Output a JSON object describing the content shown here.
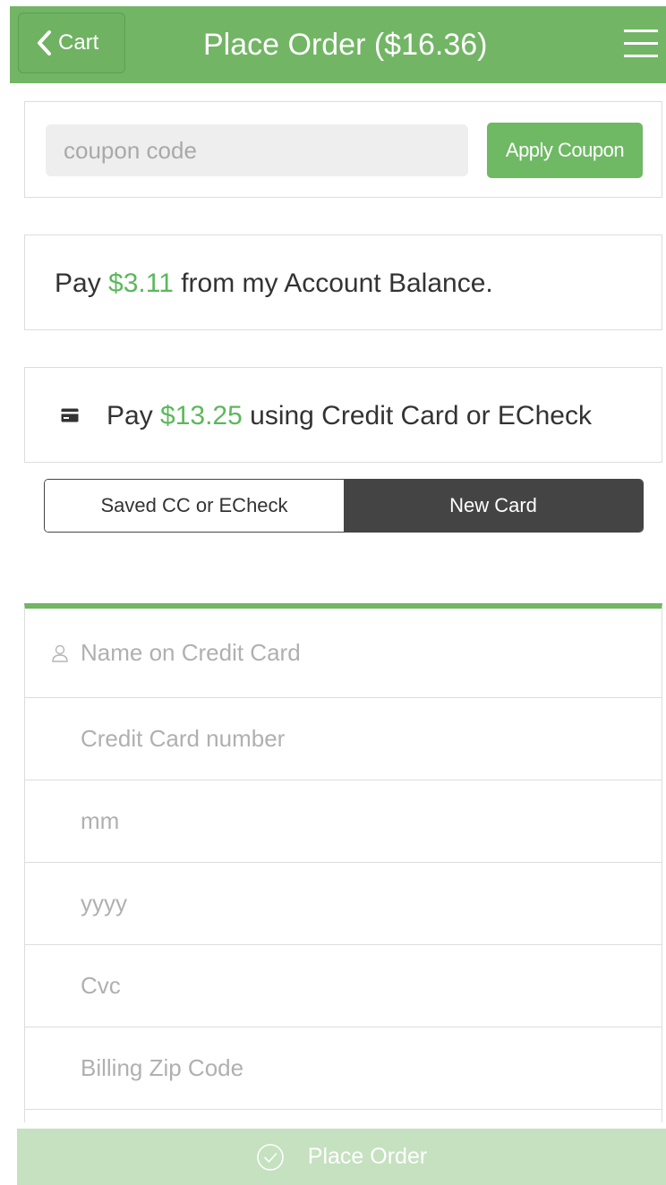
{
  "header": {
    "back_label": "Cart",
    "title": "Place Order ($16.36)",
    "color": "#72b565"
  },
  "coupon": {
    "placeholder": "coupon code",
    "apply_label": "Apply Coupon"
  },
  "account_balance": {
    "prefix": "Pay ",
    "amount": "$3.11",
    "suffix": " from my Account Balance."
  },
  "credit_card": {
    "prefix": "Pay ",
    "amount": "$13.25",
    "suffix": " using Credit Card or ECheck",
    "icon": "credit-card-icon"
  },
  "payment_tabs": {
    "saved_label": "Saved CC or ECheck",
    "new_label": "New Card",
    "selected": "New Card"
  },
  "form": {
    "name_placeholder": "Name on Credit Card",
    "number_placeholder": "Credit Card number",
    "month_placeholder": "mm",
    "year_placeholder": "yyyy",
    "cvc_placeholder": "Cvc",
    "zip_placeholder": "Billing Zip Code"
  },
  "footer": {
    "place_order_label": "Place Order",
    "icon": "check-circle-icon"
  },
  "colors": {
    "accent_green": "#72b565",
    "amount_green": "#5cb85c",
    "disabled_green": "#c5e1bf",
    "dark_tab": "#444444"
  }
}
